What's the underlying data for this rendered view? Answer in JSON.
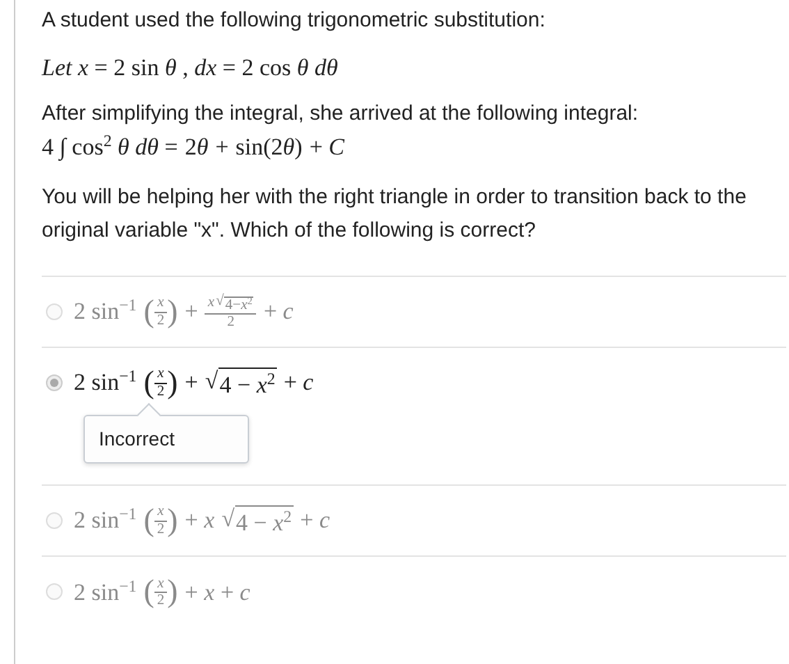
{
  "intro": "A student used the following trigonometric substitution:",
  "substitution": [
    {
      "kind": "text",
      "text": "*Let x* = 2 sin *θ* , *dx* = 2 cos *θ dθ*"
    }
  ],
  "simplified_text": "After simplifying the integral, she arrived at the following integral:",
  "integral": [
    {
      "kind": "text",
      "text": "4 ∫ cos$^{2}$ *θ dθ* ="
    },
    {
      "kind": "group",
      "body": [
        {
          "kind": "text",
          "text": "2"
        },
        {
          "kind": "text",
          "text": "*θ*"
        }
      ]
    },
    {
      "kind": "text",
      "text": "+"
    },
    {
      "kind": "group",
      "body": [
        {
          "kind": "text",
          "text": "sin(2"
        },
        {
          "kind": "text",
          "text": "*θ*"
        },
        {
          "kind": "text",
          "text": ")"
        }
      ]
    },
    {
      "kind": "text",
      "text": "+ *C*"
    }
  ],
  "question": "You will be helping her with the right triangle in order to transition back to the original variable \"x\". Which of the following is correct?",
  "options": [
    {
      "selected": false,
      "math": [
        {
          "kind": "text",
          "text": "2 sin$^{−1}$"
        },
        {
          "kind": "paren",
          "open": "(",
          "close": ")",
          "body": [
            {
              "kind": "frac",
              "num": [
                {
                  "kind": "text",
                  "text": "*x*"
                }
              ],
              "den": [
                {
                  "kind": "text",
                  "text": "2"
                }
              ]
            }
          ]
        },
        {
          "kind": "text",
          "text": "+"
        },
        {
          "kind": "frac",
          "num": [
            {
              "kind": "text",
              "text": "*x*"
            },
            {
              "kind": "sqrt",
              "sign": "√",
              "body": [
                {
                  "kind": "text",
                  "text": "4−*x*$^{2}$"
                }
              ]
            }
          ],
          "den": [
            {
              "kind": "text",
              "text": "2"
            }
          ]
        },
        {
          "kind": "text",
          "text": "+ *c*"
        }
      ]
    },
    {
      "selected": true,
      "feedback": "Incorrect",
      "math": [
        {
          "kind": "text",
          "text": "2 sin$^{−1}$"
        },
        {
          "kind": "paren",
          "open": "(",
          "close": ")",
          "body": [
            {
              "kind": "frac",
              "num": [
                {
                  "kind": "text",
                  "text": "*x*"
                }
              ],
              "den": [
                {
                  "kind": "text",
                  "text": "2"
                }
              ]
            }
          ]
        },
        {
          "kind": "text",
          "text": "+"
        },
        {
          "kind": "sqrt",
          "sign": "√",
          "body": [
            {
              "kind": "text",
              "text": "4 − *x*$^{2}$"
            }
          ]
        },
        {
          "kind": "text",
          "text": "+ *c*"
        }
      ]
    },
    {
      "selected": false,
      "math": [
        {
          "kind": "text",
          "text": "2 sin$^{−1}$"
        },
        {
          "kind": "paren",
          "open": "(",
          "close": ")",
          "body": [
            {
              "kind": "frac",
              "num": [
                {
                  "kind": "text",
                  "text": "*x*"
                }
              ],
              "den": [
                {
                  "kind": "text",
                  "text": "2"
                }
              ]
            }
          ]
        },
        {
          "kind": "text",
          "text": "+ *x*"
        },
        {
          "kind": "sqrt",
          "sign": "√",
          "body": [
            {
              "kind": "text",
              "text": "4 − *x*$^{2}$"
            }
          ]
        },
        {
          "kind": "text",
          "text": "+ *c*"
        }
      ]
    },
    {
      "selected": false,
      "math": [
        {
          "kind": "text",
          "text": "2 sin$^{−1}$"
        },
        {
          "kind": "paren",
          "open": "(",
          "close": ")",
          "body": [
            {
              "kind": "frac",
              "num": [
                {
                  "kind": "text",
                  "text": "*x*"
                }
              ],
              "den": [
                {
                  "kind": "text",
                  "text": "2"
                }
              ]
            }
          ]
        },
        {
          "kind": "text",
          "text": "+ *x* + *c*"
        }
      ]
    }
  ]
}
